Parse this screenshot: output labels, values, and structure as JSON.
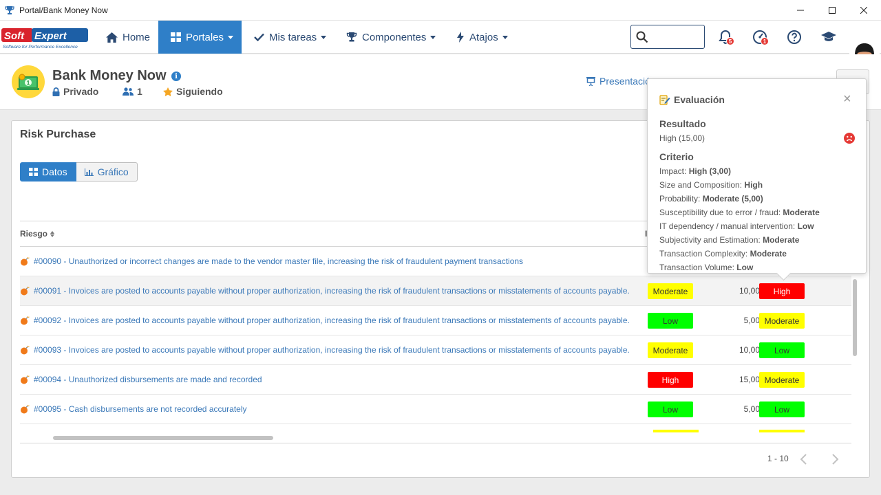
{
  "window": {
    "title": "Portal/Bank Money Now"
  },
  "nav": {
    "logo_text": "SoftExpert",
    "logo_tagline": "Software for Performance Excellence",
    "home": "Home",
    "portals": "Portales",
    "tasks": "Mis tareas",
    "components": "Componentes",
    "shortcuts": "Atajos",
    "search_placeholder": "",
    "notifications_count": "5",
    "alerts_count": "1"
  },
  "portal": {
    "title": "Bank Money Now",
    "privacy": "Privado",
    "members": "1",
    "following": "Siguiendo",
    "presentation": "Presentació"
  },
  "card": {
    "title": "Risk Purchase",
    "tab_data": "Datos",
    "tab_chart": "Gráfico",
    "col_risk": "Riesgo",
    "col_partial": "I"
  },
  "rows": [
    {
      "label": "#00090 - Unauthorized or incorrect changes are made to the vendor master file, increasing the risk of fraudulent payment transactions",
      "level": "",
      "value": "",
      "result": ""
    },
    {
      "label": "#00091 - Invoices are posted to accounts payable without proper authorization, increasing the risk of fraudulent transactions or misstatements of accounts payable.",
      "level": "Moderate",
      "value": "10,00",
      "result": "High"
    },
    {
      "label": "#00092 - Invoices are posted to accounts payable without proper authorization, increasing the risk of fraudulent transactions or misstatements of accounts payable.",
      "level": "Low",
      "value": "5,00",
      "result": "Moderate"
    },
    {
      "label": "#00093 - Invoices are posted to accounts payable without proper authorization, increasing the risk of fraudulent transactions or misstatements of accounts payable.",
      "level": "Moderate",
      "value": "10,00",
      "result": "Low"
    },
    {
      "label": "#00094 - Unauthorized disbursements are made and recorded",
      "level": "High",
      "value": "15,00",
      "result": "Moderate"
    },
    {
      "label": "#00095 - Cash disbursements are not recorded accurately",
      "level": "Low",
      "value": "5,00",
      "result": "Low"
    }
  ],
  "pagination": {
    "range": "1 - 10"
  },
  "popover": {
    "title": "Evaluación",
    "close": "×",
    "result_heading": "Resultado",
    "result_value": "High (15,00)",
    "criteria_heading": "Criterio",
    "criteria": [
      {
        "label": "Impact: ",
        "value": "High (3,00)"
      },
      {
        "label": "Size and Composition: ",
        "value": "High"
      },
      {
        "label": "Probability: ",
        "value": "Moderate (5,00)"
      },
      {
        "label": "Susceptibility due to error / fraud: ",
        "value": "Moderate"
      },
      {
        "label": "IT dependency / manual intervention: ",
        "value": "Low"
      },
      {
        "label": "Subjectivity and Estimation: ",
        "value": "Moderate"
      },
      {
        "label": "Transaction Complexity: ",
        "value": "Moderate"
      },
      {
        "label": "Transaction Volume: ",
        "value": "Low"
      }
    ]
  },
  "colors": {
    "primary": "#2f7fc8",
    "link": "#3a78b8",
    "high": "#ff0000",
    "moderate": "#ffff00",
    "low": "#00ff00",
    "badge_red": "#e53935"
  }
}
